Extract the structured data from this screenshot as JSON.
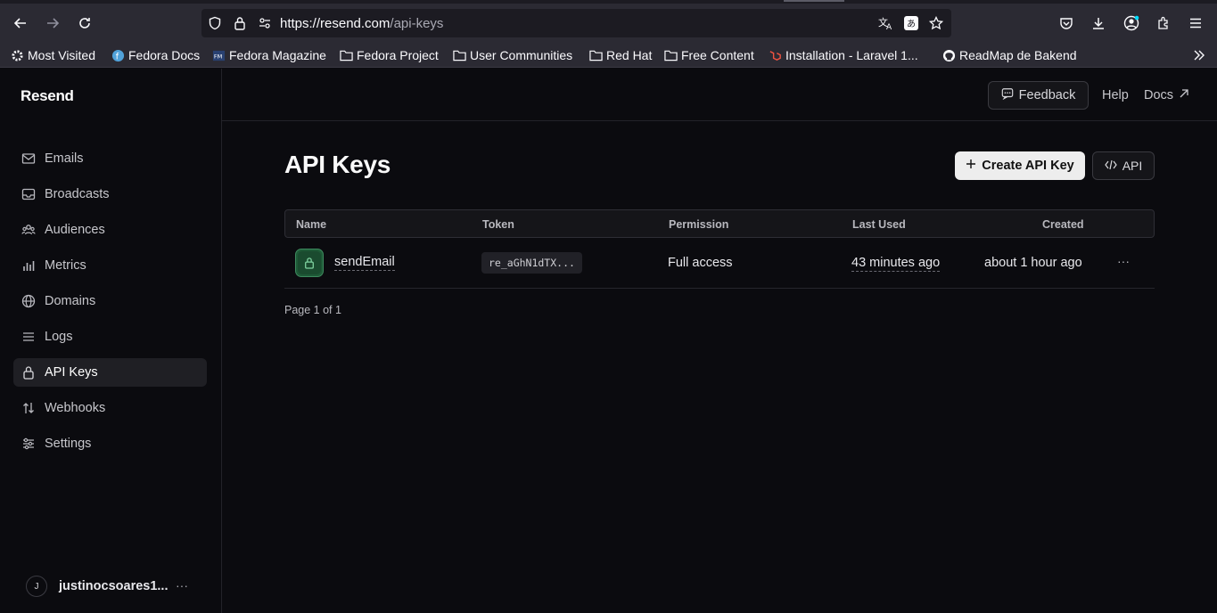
{
  "browser": {
    "url_host": "https://resend.com",
    "url_path": "/api-keys",
    "bookmarks": [
      {
        "label": "Most Visited",
        "icon": "gear-icon"
      },
      {
        "label": "Fedora Docs",
        "icon": "fedora-icon"
      },
      {
        "label": "Fedora Magazine",
        "icon": "fedora-magazine-icon"
      },
      {
        "label": "Fedora Project",
        "icon": "folder-icon"
      },
      {
        "label": "User Communities",
        "icon": "folder-icon"
      },
      {
        "label": "Red Hat",
        "icon": "folder-icon"
      },
      {
        "label": "Free Content",
        "icon": "folder-icon"
      },
      {
        "label": "Installation - Laravel 1...",
        "icon": "laravel-icon"
      },
      {
        "label": "ReadMap de Bakend",
        "icon": "github-icon"
      }
    ]
  },
  "sidebar": {
    "brand": "Resend",
    "items": [
      {
        "label": "Emails",
        "icon": "mail-icon"
      },
      {
        "label": "Broadcasts",
        "icon": "inbox-icon"
      },
      {
        "label": "Audiences",
        "icon": "users-icon"
      },
      {
        "label": "Metrics",
        "icon": "bar-chart-icon"
      },
      {
        "label": "Domains",
        "icon": "globe-icon"
      },
      {
        "label": "Logs",
        "icon": "list-icon"
      },
      {
        "label": "API Keys",
        "icon": "lock-icon",
        "active": true
      },
      {
        "label": "Webhooks",
        "icon": "arrows-icon"
      },
      {
        "label": "Settings",
        "icon": "sliders-icon"
      }
    ],
    "user": {
      "initial": "J",
      "name": "justinocsoares1...",
      "more": "···"
    }
  },
  "topbar": {
    "feedback": "Feedback",
    "help": "Help",
    "docs": "Docs"
  },
  "main": {
    "title": "API Keys",
    "create_label": "Create API Key",
    "api_label": "API",
    "columns": [
      "Name",
      "Token",
      "Permission",
      "Last Used",
      "Created"
    ],
    "rows": [
      {
        "name": "sendEmail",
        "token": "re_aGhN1dTX...",
        "permission": "Full access",
        "last_used": "43 minutes ago",
        "created": "about 1 hour ago",
        "more": "···"
      }
    ],
    "pagination": "Page 1 of 1"
  }
}
